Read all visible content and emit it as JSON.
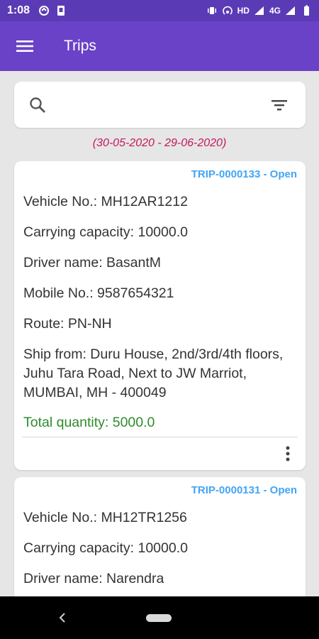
{
  "status_bar": {
    "time": "1:08",
    "network_label": "HD",
    "signal_label": "4G"
  },
  "app_bar": {
    "title": "Trips",
    "menu_icon": "hamburger-menu-icon"
  },
  "search": {
    "value": "",
    "placeholder": "",
    "search_icon": "search-icon",
    "filter_icon": "filter-icon"
  },
  "date_range": "(30-05-2020 - 29-06-2020)",
  "trips": [
    {
      "id_status": "TRIP-0000133 - Open",
      "vehicle": "Vehicle No.: MH12AR1212",
      "capacity": "Carrying capacity: 10000.0",
      "driver": "Driver name: BasantM",
      "mobile": "Mobile No.: 9587654321",
      "route": "Route: PN-NH",
      "ship_from": "Ship from: Duru House, 2nd/3rd/4th floors, Juhu Tara Road, Next to JW Marriot, MUMBAI, MH - 400049",
      "total_quantity": "Total quantity: 5000.0"
    },
    {
      "id_status": "TRIP-0000131 - Open",
      "vehicle": "Vehicle No.: MH12TR1256",
      "capacity": "Carrying capacity: 10000.0",
      "driver": "Driver name: Narendra"
    }
  ],
  "colors": {
    "status_bar": "#5b3bb5",
    "app_bar": "#6a42c7",
    "trip_id": "#42a5f5",
    "date_range": "#c2185b",
    "total_quantity": "#2e8b2e"
  }
}
